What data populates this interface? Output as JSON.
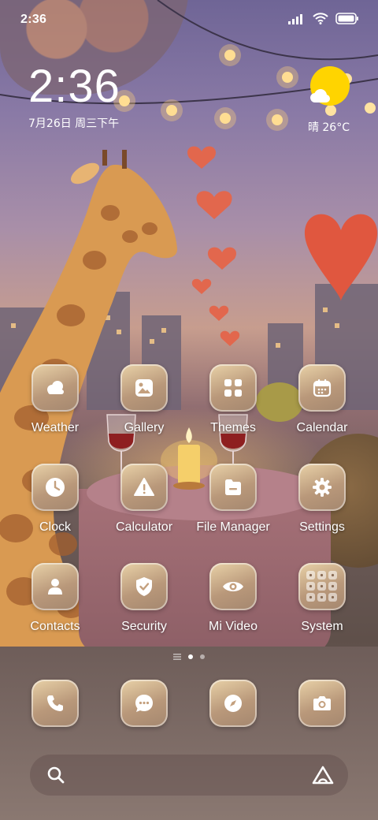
{
  "status_bar": {
    "time": "2:36",
    "icons": [
      "signal-icon",
      "wifi-icon",
      "battery-icon"
    ]
  },
  "clock_widget": {
    "time": "2:36",
    "date": "7月26日 周三下午"
  },
  "weather_widget": {
    "icon": "partly-sunny-icon",
    "text": "晴 26°C"
  },
  "apps": [
    {
      "label": "Weather",
      "icon": "weather-icon"
    },
    {
      "label": "Gallery",
      "icon": "gallery-icon"
    },
    {
      "label": "Themes",
      "icon": "themes-icon"
    },
    {
      "label": "Calendar",
      "icon": "calendar-icon"
    },
    {
      "label": "Clock",
      "icon": "clock-icon"
    },
    {
      "label": "Calculator",
      "icon": "calculator-icon"
    },
    {
      "label": "File Manager",
      "icon": "file-manager-icon"
    },
    {
      "label": "Settings",
      "icon": "settings-icon"
    },
    {
      "label": "Contacts",
      "icon": "contacts-icon"
    },
    {
      "label": "Security",
      "icon": "security-icon"
    },
    {
      "label": "Mi Video",
      "icon": "mi-video-icon"
    },
    {
      "label": "System",
      "icon": "system-folder-icon"
    }
  ],
  "page_indicator": {
    "pages": 2,
    "current": 1
  },
  "dock": [
    {
      "icon": "phone-icon"
    },
    {
      "icon": "messages-icon"
    },
    {
      "icon": "browser-icon"
    },
    {
      "icon": "camera-icon"
    }
  ],
  "search_bar": {
    "left_icon": "search-icon",
    "right_icon": "assistant-icon"
  },
  "colors": {
    "icon_bg": "#c9a985",
    "glyph": "#ffffff"
  }
}
